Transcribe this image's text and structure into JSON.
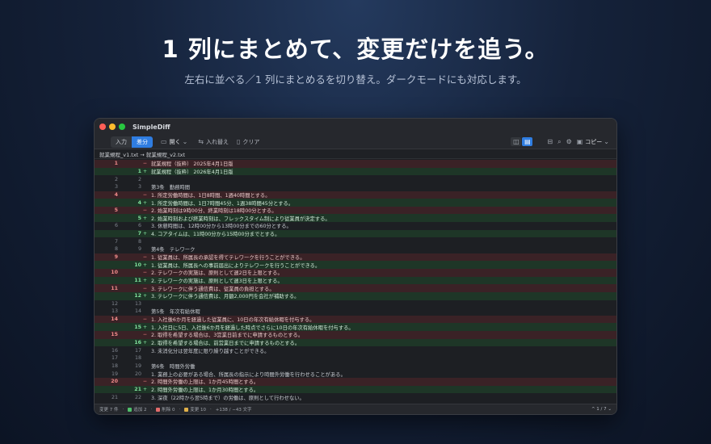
{
  "hero": {
    "title": "1 列にまとめて、変更だけを追う。",
    "subtitle": "左右に並べる／1 列にまとめるを切り替え。ダークモードにも対応します。"
  },
  "window": {
    "title": "SimpleDiff",
    "mode_tabs": [
      "入力",
      "差分"
    ],
    "active_mode": "差分",
    "toolbar": {
      "open": "開く",
      "swap": "入れ替え",
      "clear": "クリア",
      "copy": "コピー"
    },
    "icons": {
      "open": "folder-icon",
      "swap": "swap-icon",
      "clear": "trash-icon",
      "view_split": "split-view-icon",
      "view_unified": "unified-view-icon",
      "layout": "layout-icon",
      "search": "search-icon",
      "settings": "gear-icon",
      "copy": "clipboard-icon"
    },
    "path": "就業規程_v1.txt → 就業規程_v2.txt",
    "status": {
      "changes": "変更 7 件",
      "added": "追加 2",
      "deleted": "削除 0",
      "modified": "変更 10",
      "chars": "+138 / −43 文字",
      "pager": "^ 1 / 7 ⌄"
    },
    "colors": {
      "accent": "#2f7de1",
      "deleted_bg": "#3a2226",
      "added_bg": "#1e3627",
      "added_swatch": "#4fbf6b",
      "deleted_swatch": "#e26b6b",
      "modified_swatch": "#e0b04a"
    },
    "diff_rows": [
      {
        "l": "1",
        "r": "",
        "m": "−",
        "t": "就業規程（抜粋） 2025年4月1日版",
        "k": "del"
      },
      {
        "l": "",
        "r": "1",
        "m": "+",
        "t": "就業規程（抜粋） 2026年4月1日版",
        "k": "add"
      },
      {
        "l": "2",
        "r": "2",
        "m": "",
        "t": "",
        "k": "ctx"
      },
      {
        "l": "3",
        "r": "3",
        "m": "",
        "t": "第3条　勤務時間",
        "k": "ctx"
      },
      {
        "l": "4",
        "r": "",
        "m": "−",
        "t": "1. 所定労働時間は、1日8時間、1週40時間とする。",
        "k": "del"
      },
      {
        "l": "",
        "r": "4",
        "m": "+",
        "t": "1. 所定労働時間は、1日7時間45分、1週38時間45分とする。",
        "k": "add"
      },
      {
        "l": "5",
        "r": "",
        "m": "−",
        "t": "2. 始業時刻は9時00分、終業時刻は18時00分とする。",
        "k": "del"
      },
      {
        "l": "",
        "r": "5",
        "m": "+",
        "t": "2. 始業時刻および終業時刻は、フレックスタイム制により従業員が決定する。",
        "k": "add"
      },
      {
        "l": "6",
        "r": "6",
        "m": "",
        "t": "3. 休憩時間は、12時00分から13時00分までの60分とする。",
        "k": "ctx"
      },
      {
        "l": "",
        "r": "7",
        "m": "+",
        "t": "4. コアタイムは、11時00分から15時00分までとする。",
        "k": "add"
      },
      {
        "l": "7",
        "r": "8",
        "m": "",
        "t": "",
        "k": "ctx"
      },
      {
        "l": "8",
        "r": "9",
        "m": "",
        "t": "第4条　テレワーク",
        "k": "ctx"
      },
      {
        "l": "9",
        "r": "",
        "m": "−",
        "t": "1. 従業員は、所属長の承認を得てテレワークを行うことができる。",
        "k": "del"
      },
      {
        "l": "",
        "r": "10",
        "m": "+",
        "t": "1. 従業員は、所属長への事前届出によりテレワークを行うことができる。",
        "k": "add"
      },
      {
        "l": "10",
        "r": "",
        "m": "−",
        "t": "2. テレワークの実施は、原則として週2日を上限とする。",
        "k": "del"
      },
      {
        "l": "",
        "r": "11",
        "m": "+",
        "t": "2. テレワークの実施は、原則として週3日を上限とする。",
        "k": "add"
      },
      {
        "l": "11",
        "r": "",
        "m": "−",
        "t": "3. テレワークに伴う通信費は、従業員の負担とする。",
        "k": "del"
      },
      {
        "l": "",
        "r": "12",
        "m": "+",
        "t": "3. テレワークに伴う通信費は、月額2,000円を会社が補助する。",
        "k": "add"
      },
      {
        "l": "12",
        "r": "13",
        "m": "",
        "t": "",
        "k": "ctx"
      },
      {
        "l": "13",
        "r": "14",
        "m": "",
        "t": "第5条　年次有給休暇",
        "k": "ctx"
      },
      {
        "l": "14",
        "r": "",
        "m": "−",
        "t": "1. 入社後6か月を経過した従業員に、10日の年次有給休暇を付与する。",
        "k": "del"
      },
      {
        "l": "",
        "r": "15",
        "m": "+",
        "t": "1. 入社日に5日、入社後6か月を経過した時点でさらに10日の年次有給休暇を付与する。",
        "k": "add"
      },
      {
        "l": "15",
        "r": "",
        "m": "−",
        "t": "2. 取得を希望する場合は、3営業日前までに申請するものとする。",
        "k": "del"
      },
      {
        "l": "",
        "r": "16",
        "m": "+",
        "t": "2. 取得を希望する場合は、前営業日までに申請するものとする。",
        "k": "add"
      },
      {
        "l": "16",
        "r": "17",
        "m": "",
        "t": "3. 未消化分は翌年度に限り繰り越すことができる。",
        "k": "ctx"
      },
      {
        "l": "17",
        "r": "18",
        "m": "",
        "t": "",
        "k": "ctx"
      },
      {
        "l": "18",
        "r": "19",
        "m": "",
        "t": "第6条　時間外労働",
        "k": "ctx"
      },
      {
        "l": "19",
        "r": "20",
        "m": "",
        "t": "1. 業務上の必要がある場合、所属長の指示により時間外労働を行わせることがある。",
        "k": "ctx"
      },
      {
        "l": "20",
        "r": "",
        "m": "−",
        "t": "2. 時間外労働の上限は、1か月45時間とする。",
        "k": "del"
      },
      {
        "l": "",
        "r": "21",
        "m": "+",
        "t": "2. 時間外労働の上限は、1か月30時間とする。",
        "k": "add"
      },
      {
        "l": "21",
        "r": "22",
        "m": "",
        "t": "3. 深夜（22時から翌5時まで）の労働は、原則として行わせない。",
        "k": "ctx"
      }
    ]
  }
}
